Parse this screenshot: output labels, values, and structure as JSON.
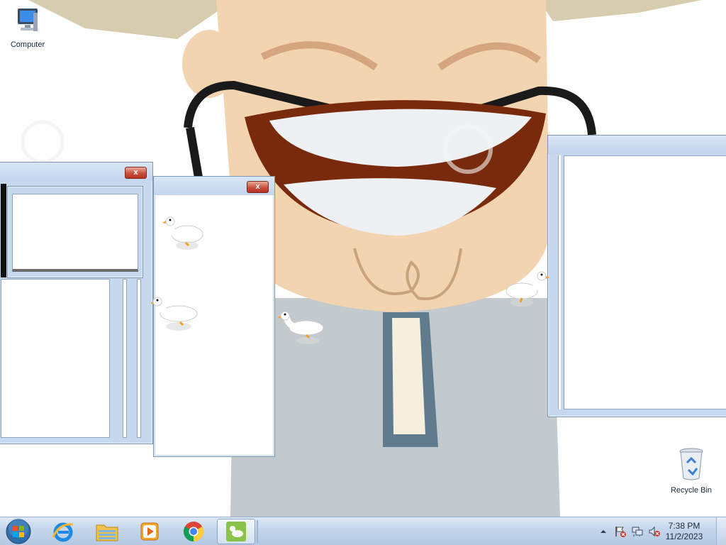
{
  "desktop": {
    "icons": [
      {
        "label": "Computer"
      },
      {
        "label": "Recycle Bin"
      }
    ],
    "watermark": "dreamstime"
  },
  "windows": [
    {
      "close_label": "x"
    },
    {
      "close_label": "x"
    }
  ],
  "taskbar": {
    "pinned": [
      {
        "icon": "windows-start-orb-icon"
      },
      {
        "icon": "internet-explorer-icon"
      },
      {
        "icon": "file-explorer-icon"
      },
      {
        "icon": "media-player-icon"
      },
      {
        "icon": "chrome-icon"
      },
      {
        "icon": "desktop-goose-icon"
      }
    ],
    "tray": {
      "icons": [
        "show-hidden-icons-chevron",
        "action-center-flag-icon",
        "network-icon",
        "volume-muted-icon"
      ],
      "time": "7:38 PM",
      "date": "11/2/2023"
    }
  }
}
